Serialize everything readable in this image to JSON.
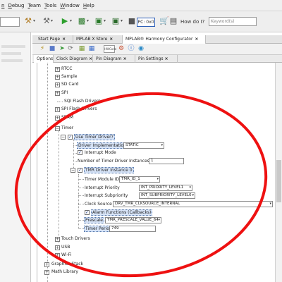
{
  "menu": [
    "n",
    "Debug",
    "Team",
    "Tools",
    "Window",
    "Help"
  ],
  "toolbar": {
    "pc_label": "PC: 0x0",
    "howdo_label": "How do I?",
    "search_placeholder": "Keyword(s)"
  },
  "editor_tabs": [
    "Start Page",
    "MPLAB X Store",
    "MPLAB® Harmony Configurator"
  ],
  "editor_toolbar": {
    "hw_code": "HWCode"
  },
  "sub_tabs": [
    "Options",
    "Clock Diagram",
    "Pin Diagram",
    "Pin Settings"
  ],
  "tree": {
    "rtcc": "RTCC",
    "sample": "Sample",
    "sdcard": "SD Card",
    "spi": "SPI",
    "sqi": "SQI Flash Drivers",
    "spiflash": "SPI Flash Drivers",
    "sram": "SRAM",
    "timer": "Timer",
    "use_timer_driver": "Use Timer Driver?",
    "driver_impl_label": "Driver Implementation",
    "driver_impl_value": "STATIC",
    "interrupt_mode": "Interrupt Mode",
    "num_instances_label": "Number of Timer Driver Instances",
    "num_instances_value": "1",
    "instance0": "TMR Driver Instance 0",
    "module_id_label": "Timer Module ID",
    "module_id_value": "TMR_ID_1",
    "int_priority_label": "Interrupt Priority",
    "int_priority_value": "INT_PRIORITY_LEVEL1",
    "int_subpriority_label": "Interrupt Subpriority",
    "int_subpriority_value": "INT_SUBPRIORITY_LEVEL0",
    "clock_source_label": "Clock Source",
    "clock_source_value": "DRV_TMR_CLKSOURCE_INTERNAL",
    "alarm_functions": "Alarm Functions (Callbacks)",
    "prescale_label": "Prescale",
    "prescale_value": "TMR_PRESCALE_VALUE_64",
    "timer_period_label": "Timer Period",
    "timer_period_value": "749",
    "touch": "Touch Drivers",
    "usb": "USB",
    "wifi": "Wi-Fi",
    "graphics": "Graphics Stack",
    "math": "Math Library"
  },
  "colors": {
    "annotation": "#ee1111",
    "selection": "#d6e3f7"
  }
}
